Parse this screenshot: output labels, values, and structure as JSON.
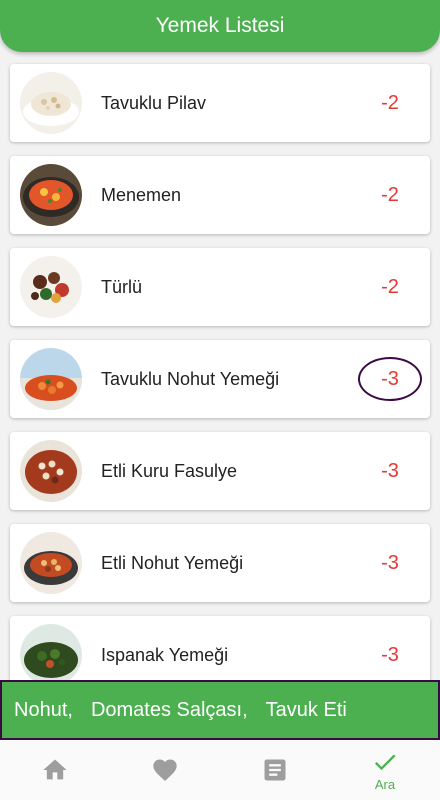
{
  "header": {
    "title": "Yemek Listesi"
  },
  "foods": [
    {
      "name": "Tavuklu Pilav",
      "score": "-2"
    },
    {
      "name": "Menemen",
      "score": "-2"
    },
    {
      "name": "Türlü",
      "score": "-2"
    },
    {
      "name": "Tavuklu Nohut Yemeği",
      "score": "-3",
      "circled": true
    },
    {
      "name": "Etli Kuru Fasulye",
      "score": "-3"
    },
    {
      "name": "Etli Nohut Yemeği",
      "score": "-3"
    },
    {
      "name": "Ispanak Yemeği",
      "score": "-3"
    }
  ],
  "selected_ingredients": [
    "Nohut,",
    "Domates Salçası,",
    "Tavuk Eti"
  ],
  "bottom_nav": {
    "items": [
      {
        "icon": "home-icon"
      },
      {
        "icon": "heart-icon"
      },
      {
        "icon": "document-icon"
      },
      {
        "icon": "check-icon",
        "label": "Ara",
        "active": true
      }
    ]
  },
  "colors": {
    "primary": "#4caf50",
    "score": "#e53935",
    "ring": "#3b0a45"
  }
}
